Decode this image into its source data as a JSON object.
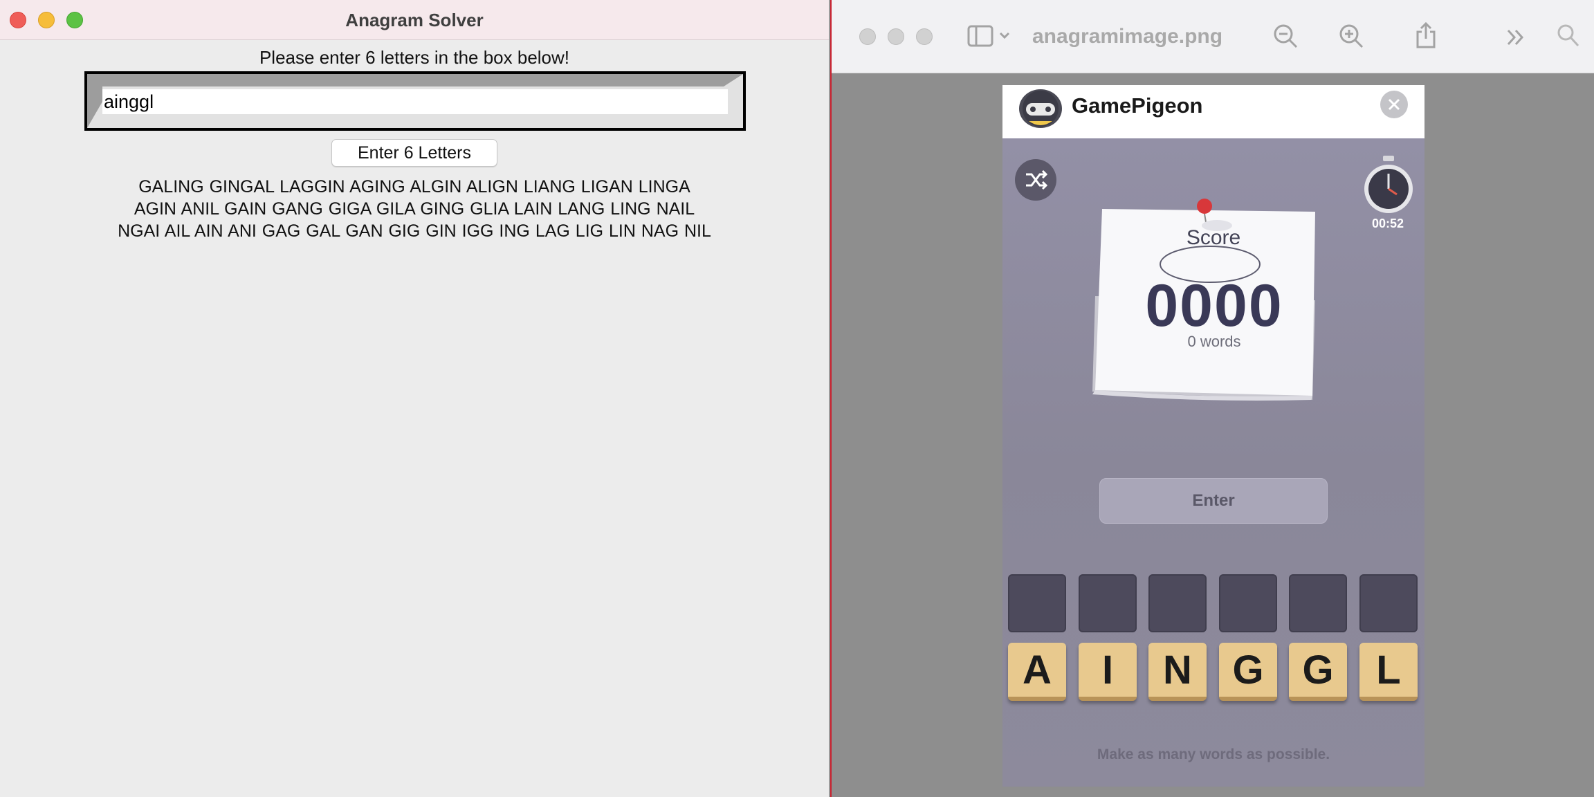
{
  "solver": {
    "window_title": "Anagram Solver",
    "prompt": "Please enter 6 letters in the box below!",
    "input_value": "ainggl",
    "button_label": "Enter 6 Letters",
    "results_text": "GALING GINGAL LAGGIN AGING ALGIN ALIGN LIANG LIGAN LINGA AGIN ANIL GAIN GANG GIGA GILA GING GLIA LAIN LANG LING NAIL NGAI AIL AIN ANI GAG GAL GAN GIG GIN IGG ING LAG LIG LIN NAG NIL"
  },
  "preview": {
    "file_name": "anagramimage.png",
    "game": {
      "app_name": "GamePigeon",
      "timer": "00:52",
      "score_label": "Score",
      "score": "0000",
      "words_count": "0 words",
      "enter_label": "Enter",
      "tiles": [
        "A",
        "I",
        "N",
        "G",
        "G",
        "L"
      ],
      "hint": "Make as many words as possible."
    }
  },
  "colors": {
    "window_bg": "#ececec",
    "titlebar_bg": "#f6e9ec",
    "close_red": "#ef5d58",
    "minimize_yellow": "#f6bd3a",
    "zoom_green": "#5cc244",
    "tile_wood": "#e8c98e",
    "score_color": "#3a3957"
  }
}
